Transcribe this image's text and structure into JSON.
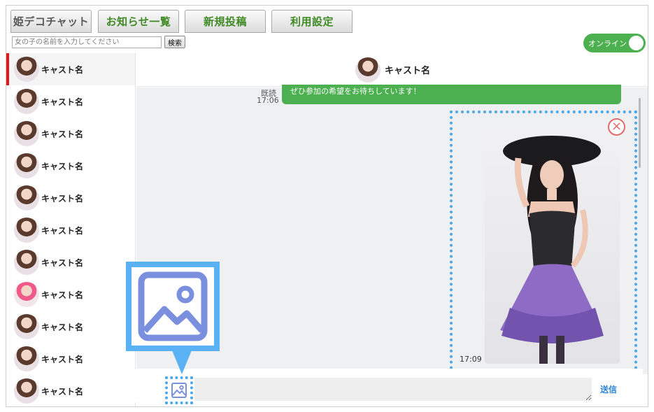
{
  "tabs": [
    {
      "label": "姫デコチャット"
    },
    {
      "label": "お知らせ一覧"
    },
    {
      "label": "新規投稿"
    },
    {
      "label": "利用設定"
    }
  ],
  "search": {
    "placeholder": "女の子の名前を入力してください",
    "button": "検索"
  },
  "status": {
    "label": "オンライン"
  },
  "sidebar": {
    "items": [
      {
        "label": "キャスト名"
      },
      {
        "label": "キャスト名"
      },
      {
        "label": "キャスト名"
      },
      {
        "label": "キャスト名"
      },
      {
        "label": "キャスト名"
      },
      {
        "label": "キャスト名"
      },
      {
        "label": "キャスト名"
      },
      {
        "label": "キャスト名"
      },
      {
        "label": "キャスト名"
      },
      {
        "label": "キャスト名"
      },
      {
        "label": "キャスト名"
      }
    ]
  },
  "chat": {
    "header_name": "キャスト名",
    "read_label": "既読",
    "msg1_time": "17:06",
    "msg1_text": "ぜひ参加の希望をお待ちしています！",
    "msg2_time": "17:09",
    "send_label": "送信"
  },
  "colors": {
    "accent_green": "#4caf50",
    "highlight_blue": "#4aa8ec",
    "icon_blue": "#7b8fdf",
    "active_red": "#e5151b"
  }
}
